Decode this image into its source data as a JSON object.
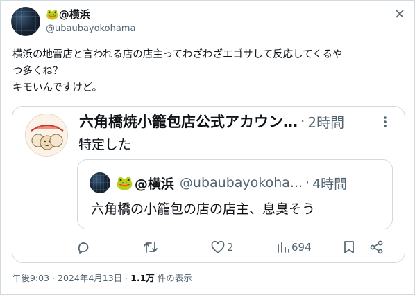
{
  "window": {
    "close_icon": "close-icon"
  },
  "author": {
    "display_name": "@横浜",
    "name_emoji": "🐸",
    "handle": "@ubaubayokohama",
    "avatar": "dark-cityscape-avatar"
  },
  "tweet": {
    "line1": "横浜の地雷店と言われる店の店主ってわざわざエゴサして反応してくるや",
    "line2": "つ多くね？",
    "line3": "キモいんですけど。"
  },
  "quote": {
    "display_name": "六角橋焼小籠包店公式アカウン…",
    "separator": "·",
    "time": "2時間",
    "text": "特定した",
    "avatar": "shop-logo-avatar",
    "more_icon": "more-vertical-icon",
    "nested": {
      "name_emoji": "🐸",
      "display_name": "@横浜",
      "handle": "@ubaubayokoha...",
      "separator": "·",
      "time": "4時間",
      "text": "六角橋の小籠包の店の店主、息臭そう"
    }
  },
  "actions": {
    "reply_icon": "reply-icon",
    "retweet_icon": "retweet-icon",
    "like_icon": "heart-icon",
    "like_count": "2",
    "views_icon": "views-icon",
    "view_count": "694",
    "bookmark_icon": "bookmark-icon",
    "share_icon": "share-icon"
  },
  "meta": {
    "time": "午後9:03",
    "dot": "·",
    "date": "2024年4月13日",
    "views_num": "1.1万",
    "views_label": "件の表示"
  },
  "colors": {
    "text": "#0f1419",
    "secondary": "#536471",
    "border": "#cfd9de",
    "frog_green": "#58b947"
  }
}
